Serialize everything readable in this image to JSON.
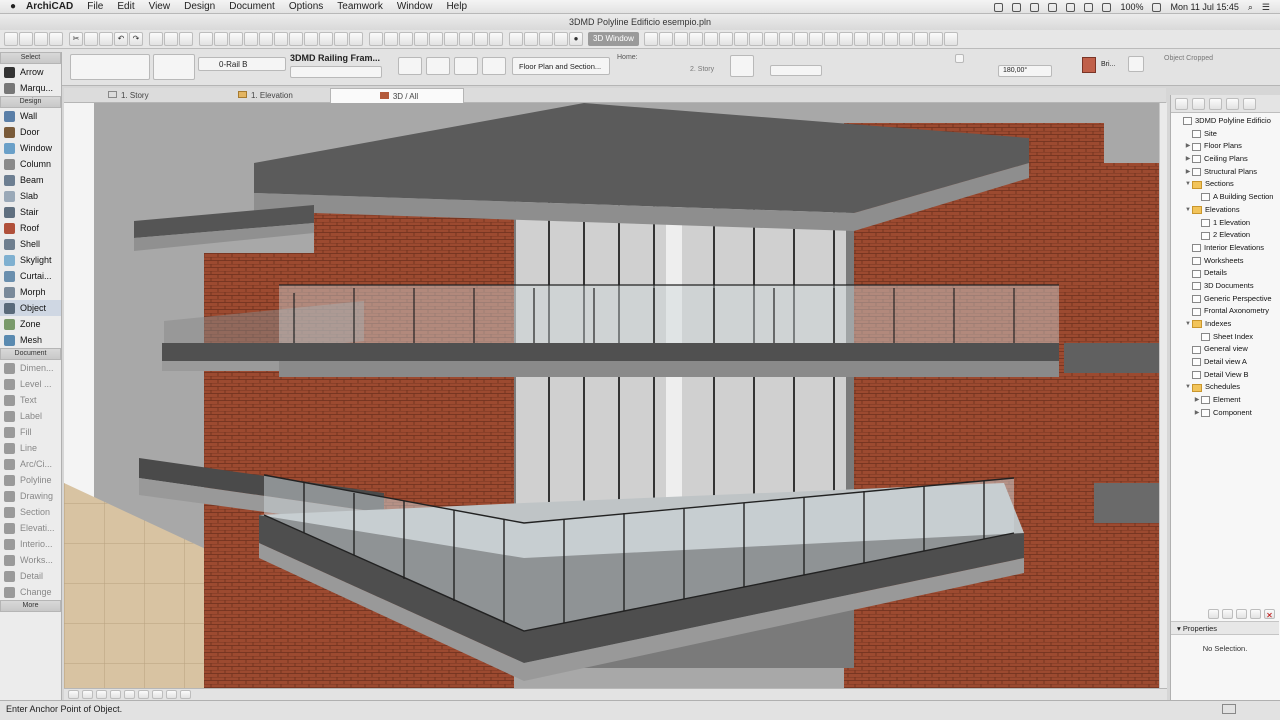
{
  "menubar": {
    "app": "ArchiCAD",
    "items": [
      "File",
      "Edit",
      "View",
      "Design",
      "Document",
      "Options",
      "Teamwork",
      "Window",
      "Help"
    ],
    "battery": "100%",
    "datetime": "Mon 11 Jul  15:45"
  },
  "window": {
    "title": "3DMD Polyline Edificio esempio.pln"
  },
  "toolbar": {
    "view_3d_label": "3D Window"
  },
  "infobox": {
    "rail_label": "0-Rail B",
    "object_name": "3DMD Railing Fram...",
    "section_label": "Floor Plan and Section...",
    "home_label": "Home:",
    "story_label": "2. Story",
    "angle_value": "180,00°",
    "material_label": "Bri...",
    "cropped_label": "Object Cropped"
  },
  "tabs": [
    {
      "label": "1. Story"
    },
    {
      "label": "1. Elevation"
    },
    {
      "label": "3D / All"
    }
  ],
  "toolbox": {
    "select_header": "Select",
    "select_tools": [
      {
        "label": "Arrow",
        "icon": "arrow-icon"
      },
      {
        "label": "Marqu...",
        "icon": "marquee-icon"
      }
    ],
    "design_header": "Design",
    "design_tools": [
      {
        "label": "Wall",
        "icon": "wall-icon"
      },
      {
        "label": "Door",
        "icon": "door-icon"
      },
      {
        "label": "Window",
        "icon": "window-icon"
      },
      {
        "label": "Column",
        "icon": "column-icon"
      },
      {
        "label": "Beam",
        "icon": "beam-icon"
      },
      {
        "label": "Slab",
        "icon": "slab-icon"
      },
      {
        "label": "Stair",
        "icon": "stair-icon"
      },
      {
        "label": "Roof",
        "icon": "roof-icon"
      },
      {
        "label": "Shell",
        "icon": "shell-icon"
      },
      {
        "label": "Skylight",
        "icon": "skylight-icon"
      },
      {
        "label": "Curtai...",
        "icon": "curtain-wall-icon"
      },
      {
        "label": "Morph",
        "icon": "morph-icon"
      },
      {
        "label": "Object",
        "icon": "object-icon"
      },
      {
        "label": "Zone",
        "icon": "zone-icon"
      },
      {
        "label": "Mesh",
        "icon": "mesh-icon"
      }
    ],
    "document_header": "Document",
    "document_tools": [
      {
        "label": "Dimen...",
        "icon": "dimension-icon"
      },
      {
        "label": "Level ...",
        "icon": "level-dimension-icon"
      },
      {
        "label": "Text",
        "icon": "text-icon"
      },
      {
        "label": "Label",
        "icon": "label-icon"
      },
      {
        "label": "Fill",
        "icon": "fill-icon"
      },
      {
        "label": "Line",
        "icon": "line-icon"
      },
      {
        "label": "Arc/Ci...",
        "icon": "arc-circle-icon"
      },
      {
        "label": "Polyline",
        "icon": "polyline-icon"
      },
      {
        "label": "Drawing",
        "icon": "drawing-icon"
      },
      {
        "label": "Section",
        "icon": "section-icon"
      },
      {
        "label": "Elevati...",
        "icon": "elevation-icon"
      },
      {
        "label": "Interio...",
        "icon": "interior-elevation-icon"
      },
      {
        "label": "Works...",
        "icon": "worksheet-icon"
      },
      {
        "label": "Detail",
        "icon": "detail-icon"
      },
      {
        "label": "Change",
        "icon": "change-icon"
      }
    ],
    "more_header": "More"
  },
  "navigator": {
    "tree": [
      {
        "label": "3DMD Polyline Edificio",
        "level": 0,
        "type": "project"
      },
      {
        "label": "Site",
        "level": 1,
        "type": "item"
      },
      {
        "label": "Floor Plans",
        "level": 1,
        "type": "item",
        "arrow": "▶"
      },
      {
        "label": "Ceiling Plans",
        "level": 1,
        "type": "item",
        "arrow": "▶"
      },
      {
        "label": "Structural Plans",
        "level": 1,
        "type": "item",
        "arrow": "▶"
      },
      {
        "label": "Sections",
        "level": 1,
        "type": "folder",
        "arrow": "▼"
      },
      {
        "label": "A Building Section",
        "level": 2,
        "type": "item"
      },
      {
        "label": "Elevations",
        "level": 1,
        "type": "folder",
        "arrow": "▼"
      },
      {
        "label": "1 Elevation",
        "level": 2,
        "type": "item"
      },
      {
        "label": "2 Elevation",
        "level": 2,
        "type": "item"
      },
      {
        "label": "Interior Elevations",
        "level": 1,
        "type": "item"
      },
      {
        "label": "Worksheets",
        "level": 1,
        "type": "item"
      },
      {
        "label": "Details",
        "level": 1,
        "type": "item"
      },
      {
        "label": "3D Documents",
        "level": 1,
        "type": "item"
      },
      {
        "label": "Generic Perspective",
        "level": 1,
        "type": "item"
      },
      {
        "label": "Frontal Axonometry",
        "level": 1,
        "type": "item"
      },
      {
        "label": "Indexes",
        "level": 1,
        "type": "folder",
        "arrow": "▼"
      },
      {
        "label": "Sheet Index",
        "level": 2,
        "type": "item"
      },
      {
        "label": "General view",
        "level": 1,
        "type": "item"
      },
      {
        "label": "Detail view A",
        "level": 1,
        "type": "item"
      },
      {
        "label": "Detail View B",
        "level": 1,
        "type": "item"
      },
      {
        "label": "Schedules",
        "level": 1,
        "type": "folder",
        "arrow": "▼"
      },
      {
        "label": "Element",
        "level": 2,
        "type": "item",
        "arrow": "▶"
      },
      {
        "label": "Component",
        "level": 2,
        "type": "item",
        "arrow": "▶"
      }
    ],
    "properties_header": "Properties",
    "no_selection": "No Selection."
  },
  "status": {
    "message": "Enter Anchor Point of Object."
  }
}
